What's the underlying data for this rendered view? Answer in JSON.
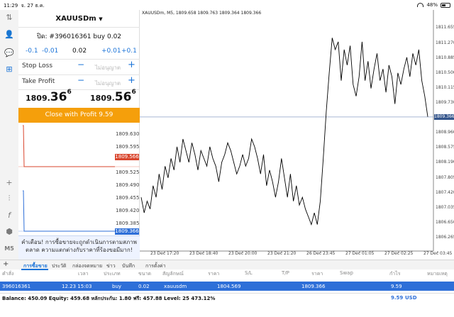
{
  "status_bar": {
    "time": "11:29",
    "date": "จ. 27 ธ.ค.",
    "battery": "48%"
  },
  "trade": {
    "symbol": "XAUUSDm",
    "position": "ปิด: #396016361 buy 0.02",
    "volume": {
      "m01": "-0.1",
      "m001": "-0.01",
      "value": "0.02",
      "p001": "+0.01",
      "p01": "+0.1"
    },
    "stop_loss": {
      "label": "Stop Loss",
      "placeholder": "ไม่อนุญาต"
    },
    "take_profit": {
      "label": "Take Profit",
      "placeholder": "ไม่อนุญาต"
    },
    "bid": {
      "big": "1809.",
      "digits": "36",
      "sup": "6"
    },
    "ask": {
      "big": "1809.",
      "digits": "56",
      "sup": "6"
    },
    "close_button": "Close with Profit 9.59",
    "mini_ticks": [
      "1809.630",
      "1809.595",
      "1809.525",
      "1809.490",
      "1809.455",
      "1809.420",
      "1809.385"
    ],
    "mini_tag_red": "1809.566",
    "mini_tag_blue": "1809.366",
    "mini_color_red": "#d9462e",
    "mini_color_blue": "#2e6fd8",
    "warning": "คำเตือน! การซื้อขายจะถูกดำเนินการตามสภาพตลาด ความแตกต่างกับราคาที่ร้องขอมีมาก!"
  },
  "chart_data": {
    "type": "line",
    "title": "XAUUSDm, M5, 1809.658 1809.763 1809.364 1809.366",
    "y_ticks": [
      "1811.655",
      "1811.270",
      "1810.885",
      "1810.500",
      "1810.115",
      "1809.730",
      "1808.960",
      "1808.575",
      "1808.190",
      "1807.805",
      "1807.420",
      "1807.035",
      "1806.650",
      "1806.265"
    ],
    "x_ticks": [
      "23 Dec 17:20",
      "23 Dec 18:40",
      "23 Dec 20:00",
      "23 Dec 21:20",
      "26 Dec 23:45",
      "27 Dec 01:05",
      "27 Dec 02:25",
      "27 Dec 03:45"
    ],
    "ylim": [
      1806.1,
      1811.9
    ],
    "current_price": "1809.366",
    "line_color": "#000000",
    "price_line_color": "#a9b7d4",
    "values": [
      1807.3,
      1806.9,
      1807.2,
      1807.0,
      1807.6,
      1807.3,
      1807.9,
      1807.5,
      1808.1,
      1807.8,
      1808.3,
      1808.0,
      1808.6,
      1808.2,
      1808.8,
      1808.5,
      1808.2,
      1808.7,
      1808.4,
      1808.0,
      1808.5,
      1808.3,
      1808.1,
      1808.6,
      1808.3,
      1808.1,
      1807.7,
      1808.2,
      1808.4,
      1808.7,
      1808.5,
      1808.2,
      1807.9,
      1808.1,
      1808.4,
      1808.1,
      1808.3,
      1808.8,
      1808.6,
      1808.3,
      1807.9,
      1808.4,
      1807.6,
      1808.0,
      1807.7,
      1807.3,
      1807.7,
      1808.3,
      1807.8,
      1807.3,
      1807.9,
      1807.2,
      1807.6,
      1807.1,
      1807.3,
      1807.0,
      1806.8,
      1806.6,
      1806.9,
      1806.6,
      1807.2,
      1808.3,
      1809.5,
      1810.5,
      1811.4,
      1811.1,
      1811.3,
      1810.3,
      1811.1,
      1810.7,
      1811.2,
      1810.2,
      1809.9,
      1810.4,
      1811.3,
      1810.3,
      1810.8,
      1810.1,
      1810.6,
      1811.0,
      1810.3,
      1810.6,
      1810.0,
      1810.7,
      1810.4,
      1809.7,
      1810.5,
      1810.2,
      1810.6,
      1810.9,
      1810.4,
      1811.0,
      1810.7,
      1811.1,
      1810.3,
      1809.9,
      1809.37
    ]
  },
  "tabs": [
    "การซื้อขาย",
    "ประวัติ",
    "กล่องจดหมาย",
    "ข่าว",
    "บันทึก",
    "การตั้งค่า"
  ],
  "table": {
    "headers": [
      "คำสั่ง",
      "เวลา",
      "ประเภท",
      "ขนาด",
      "สัญลักษณ์",
      "ราคา",
      "S/L",
      "T/P",
      "ราคา",
      "Swap",
      "กำไร",
      "หมายเหตุ"
    ],
    "row": {
      "order": "396016361",
      "time": "12.23 15:03",
      "type": "buy",
      "size": "0.02",
      "symbol": "xauusdm",
      "price_open": "1804.569",
      "price_now": "1809.366",
      "profit": "9.59"
    },
    "summary": "Balance: 450.09 Equity: 459.68 หลักประกัน: 1.80 ฟรี: 457.88 Level: 25 473.12%",
    "total_profit": "9.59",
    "currency": "USD"
  }
}
